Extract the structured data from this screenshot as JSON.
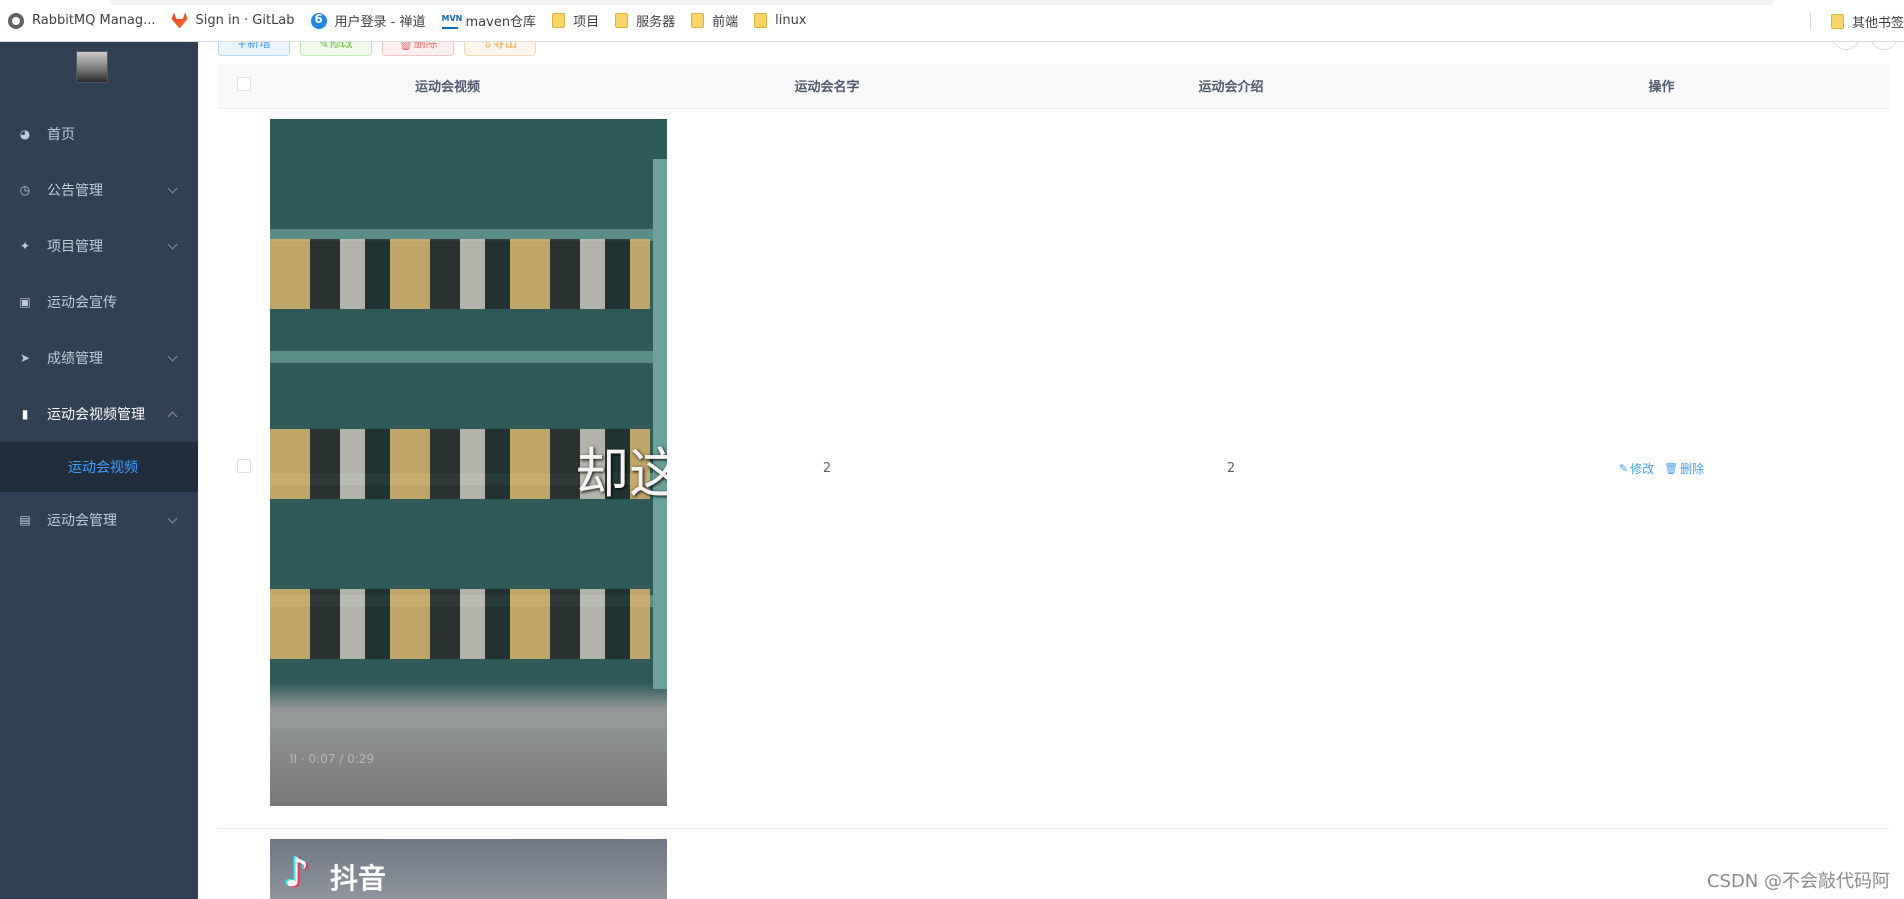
{
  "bookmarks": {
    "items": [
      {
        "label": "RabbitMQ Manag...",
        "icon": "rabbitmq-icon"
      },
      {
        "label": "Sign in · GitLab",
        "icon": "gitlab-icon"
      },
      {
        "label": "用户登录 - 禅道",
        "icon": "zentao-icon"
      },
      {
        "label": "maven仓库",
        "icon": "maven-icon"
      },
      {
        "label": "项目",
        "icon": "folder-icon"
      },
      {
        "label": "服务器",
        "icon": "folder-icon"
      },
      {
        "label": "前端",
        "icon": "folder-icon"
      },
      {
        "label": "linux",
        "icon": "folder-icon"
      }
    ],
    "other": "其他书签"
  },
  "sidebar": {
    "items": [
      {
        "label": "首页",
        "icon": "dashboard-icon"
      },
      {
        "label": "公告管理",
        "icon": "clock-icon"
      },
      {
        "label": "项目管理",
        "icon": "compass-icon"
      },
      {
        "label": "运动会宣传",
        "icon": "picture-icon"
      },
      {
        "label": "成绩管理",
        "icon": "send-icon"
      },
      {
        "label": "运动会视频管理",
        "icon": "bar-chart-icon"
      },
      {
        "label": "运动会管理",
        "icon": "document-icon"
      }
    ],
    "submenu": {
      "label": "运动会视频"
    }
  },
  "toolbar": {
    "add": "新增",
    "edit": "修改",
    "delete": "删除",
    "export": "导出"
  },
  "table": {
    "columns": [
      "运动会视频",
      "运动会名字",
      "运动会介绍",
      "操作"
    ],
    "rows": [
      {
        "name": "2",
        "intro": "2",
        "video_caption": "却这",
        "video_timecode": "II · 0:07 / 0:29",
        "edit": "修改",
        "delete": "删除"
      },
      {
        "video_brand": "抖音"
      }
    ]
  },
  "watermark": "CSDN @不会敲代码阿",
  "colors": {
    "sidebar_bg": "#304156",
    "submenu_bg": "#1f2d3d",
    "accent": "#409eff"
  }
}
